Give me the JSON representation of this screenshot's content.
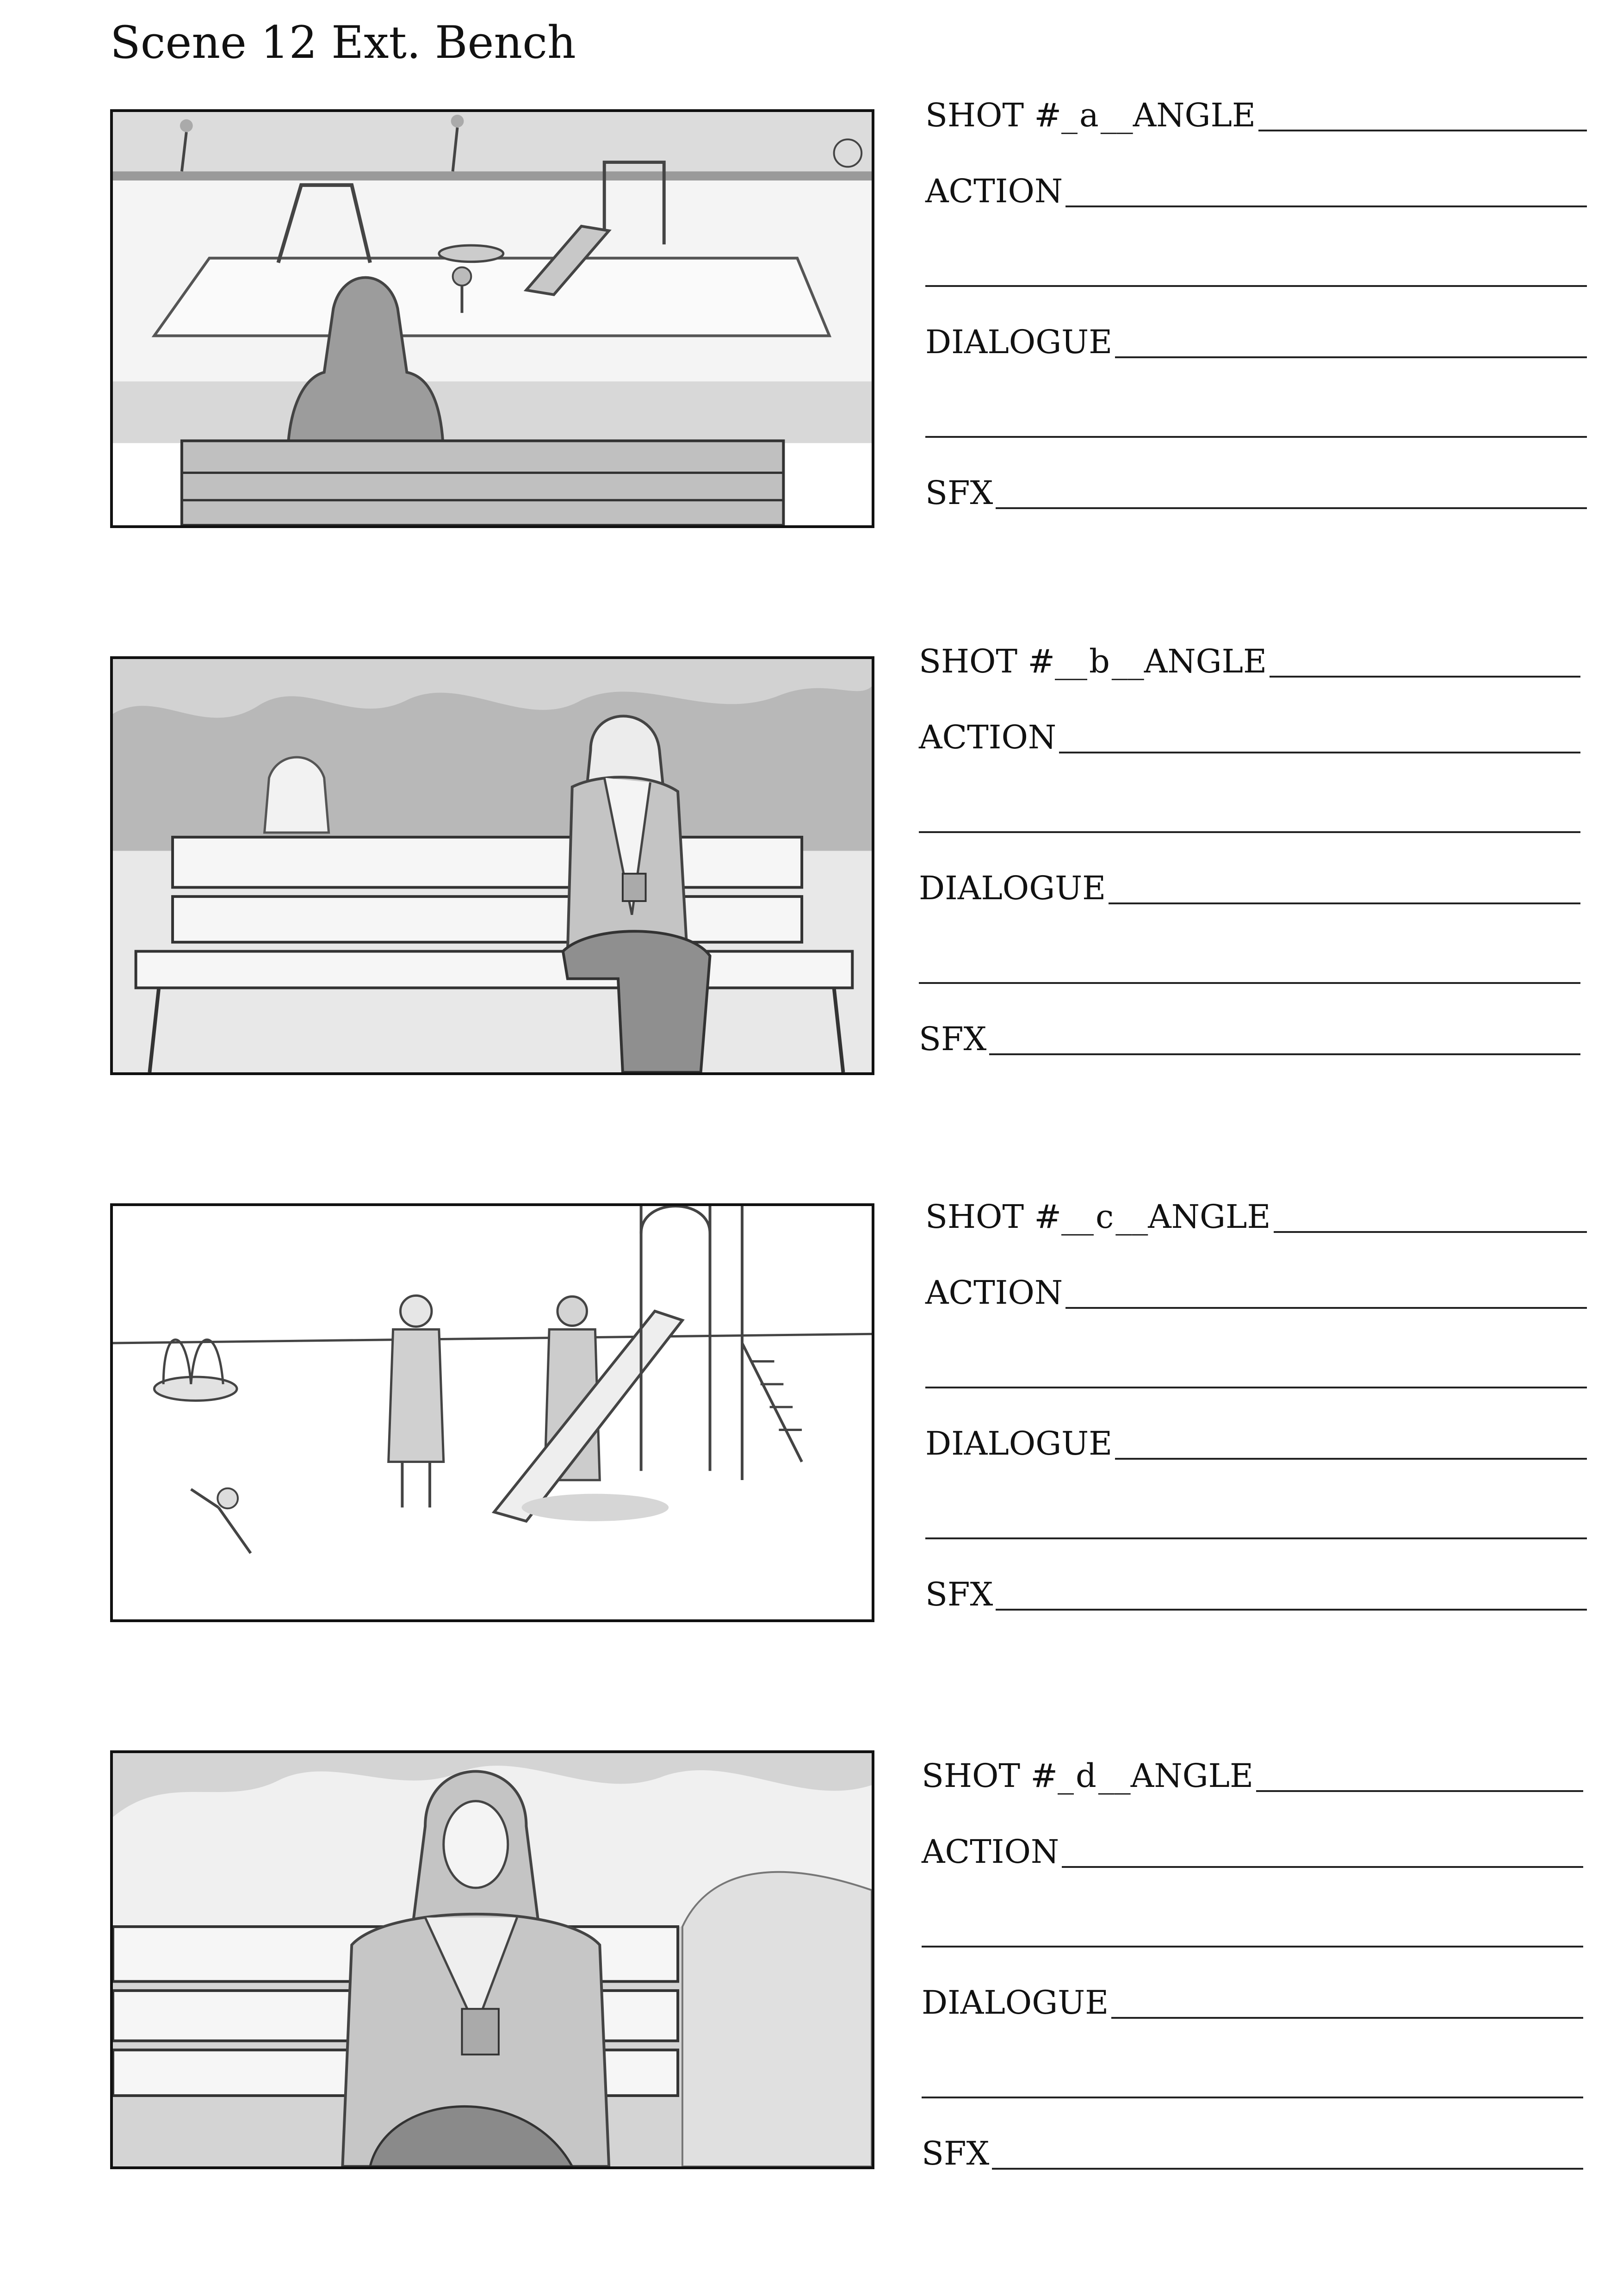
{
  "page": {
    "title": "Scene 12 Ext. Bench"
  },
  "labels": {
    "shot_prefix": "SHOT #_",
    "angle": "ANGLE",
    "action": "ACTION",
    "dialogue": "DIALOGUE",
    "sfx": "SFX"
  },
  "panels": [
    {
      "shot": "a",
      "scene": "playground-wide-back-view"
    },
    {
      "shot": "b",
      "scene": "woman-on-bench-side-view"
    },
    {
      "shot": "c",
      "scene": "playground-slide-families"
    },
    {
      "shot": "d",
      "scene": "woman-on-bench-front-view"
    }
  ],
  "colors": {
    "ink": "#111111",
    "sketch_light": "#e6e6e6",
    "sketch_mid": "#c4c4c4",
    "sketch_dark": "#8f8f8f"
  }
}
